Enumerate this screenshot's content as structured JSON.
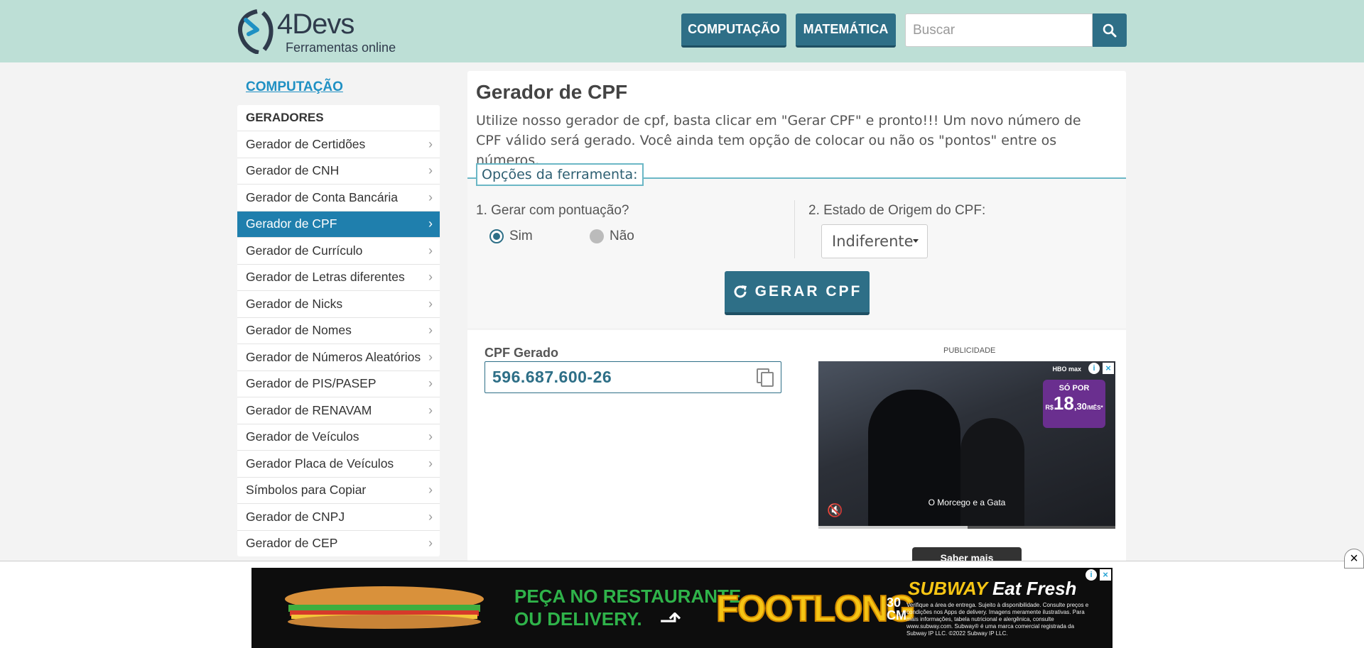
{
  "header": {
    "logo_brand": "4Devs",
    "logo_tagline": "Ferramentas online",
    "nav": [
      {
        "label": "COMPUTAÇÃO"
      },
      {
        "label": "MATEMÁTICA"
      }
    ],
    "search_placeholder": "Buscar"
  },
  "sidebar": {
    "section_link": "COMPUTAÇÃO",
    "group_title": "GERADORES",
    "items": [
      {
        "label": "Gerador de Certidões"
      },
      {
        "label": "Gerador de CNH"
      },
      {
        "label": "Gerador de Conta Bancária"
      },
      {
        "label": "Gerador de CPF",
        "active": true
      },
      {
        "label": "Gerador de Currículo"
      },
      {
        "label": "Gerador de Letras diferentes"
      },
      {
        "label": "Gerador de Nicks"
      },
      {
        "label": "Gerador de Nomes"
      },
      {
        "label": "Gerador de Números Aleatórios"
      },
      {
        "label": "Gerador de PIS/PASEP"
      },
      {
        "label": "Gerador de RENAVAM"
      },
      {
        "label": "Gerador de Veículos"
      },
      {
        "label": "Gerador Placa de Veículos"
      },
      {
        "label": "Símbolos para Copiar"
      },
      {
        "label": "Gerador de CNPJ"
      },
      {
        "label": "Gerador de CEP"
      }
    ]
  },
  "main": {
    "title": "Gerador de CPF",
    "description": "Utilize nosso gerador de cpf, basta clicar em \"Gerar CPF\" e pronto!!! Um novo número de CPF válido será gerado. Você ainda tem opção de colocar ou não os \"pontos\" entre os números.",
    "options_legend": "Opções da ferramenta:",
    "option1_label": "1. Gerar com pontuação?",
    "radio_sim": "Sim",
    "radio_nao": "Não",
    "radio_selected": "Sim",
    "option2_label": "2. Estado de Origem do CPF:",
    "state_selected": "Indiferente",
    "generate_button": "GERAR CPF"
  },
  "result": {
    "label": "CPF Gerado",
    "value": "596.687.600-26"
  },
  "ad_side": {
    "label": "PUBLICIDADE",
    "brand": "HBO max",
    "price_prefix": "SÓ POR",
    "price_currency": "R$",
    "price_value": "18",
    "price_cents": ",30",
    "price_unit": "/MÊS*",
    "video_title": "O Morcego e a Gata",
    "cta": "Saber mais"
  },
  "ad_banner": {
    "headline_line1": "PEÇA NO RESTAURANTE",
    "headline_line2": "OU DELIVERY.",
    "product": "FOOTLONG",
    "product_size_num": "30",
    "product_size_unit": "CM",
    "brand": "SUBWAY",
    "slogan": "Eat Fresh",
    "fine_print": "Verifique a área de entrega. Sujeito à disponibilidade. Consulte preços e condições nos Apps de delivery. Imagens meramente ilustrativas. Para mais informações, tabela nutricional e alergênica, consulte www.subway.com. Subway® é uma marca comercial registrada da Subway IP LLC. ©2022 Subway IP LLC."
  },
  "colors": {
    "header_bg": "#bddfd6",
    "primary": "#2e6f87",
    "active_item": "#1f7fad",
    "link": "#1f90c3"
  }
}
